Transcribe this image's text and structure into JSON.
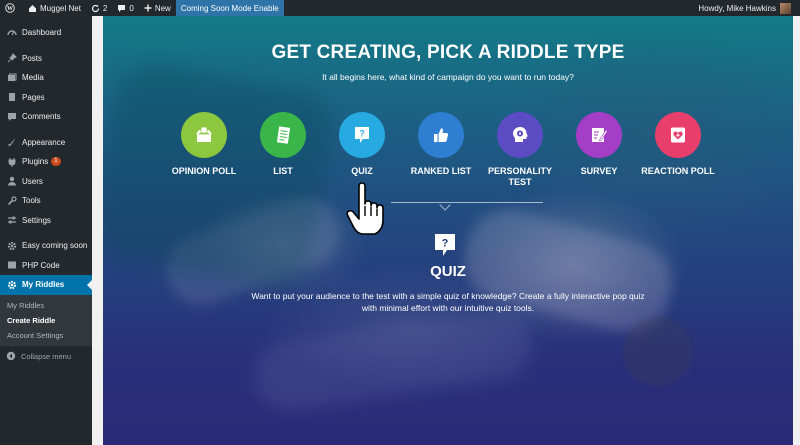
{
  "adminbar": {
    "site_name": "Muggel Net",
    "updates_count": "2",
    "comments_count": "0",
    "new_label": "New",
    "coming_soon_label": "Coming Soon Mode Enable",
    "howdy": "Howdy, Mike Hawkins"
  },
  "sidebar": {
    "dashboard": "Dashboard",
    "posts": "Posts",
    "media": "Media",
    "pages": "Pages",
    "comments": "Comments",
    "appearance": "Appearance",
    "plugins": "Plugins",
    "plugins_badge": "1",
    "users": "Users",
    "tools": "Tools",
    "settings": "Settings",
    "easy_coming_soon": "Easy coming soon",
    "php_code": "PHP Code",
    "my_riddles": "My Riddles",
    "sub_my_riddles": "My Riddles",
    "sub_create_riddle": "Create Riddle",
    "sub_account_settings": "Account Settings",
    "collapse": "Collapse menu"
  },
  "main": {
    "headline": "GET CREATING, PICK A RIDDLE TYPE",
    "subline": "It all begins here, what kind of campaign do you want to run today?",
    "types": [
      {
        "label": "OPINION POLL",
        "color": "#8dc63f",
        "icon": "ballot-box-icon"
      },
      {
        "label": "LIST",
        "color": "#39b54a",
        "icon": "list-icon"
      },
      {
        "label": "QUIZ",
        "color": "#27aae1",
        "icon": "question-icon"
      },
      {
        "label": "RANKED LIST",
        "color": "#2e7fd1",
        "icon": "thumbs-up-icon"
      },
      {
        "label": "PERSONALITY TEST",
        "color": "#5b4cc4",
        "icon": "head-brain-icon"
      },
      {
        "label": "SURVEY",
        "color": "#a43ec6",
        "icon": "survey-pencil-icon"
      },
      {
        "label": "REACTION POLL",
        "color": "#e83e6c",
        "icon": "heart-plus-icon"
      }
    ],
    "selected": {
      "title": "QUIZ",
      "description": "Want to put your audience to the test with a simple quiz of knowledge? Create a fully interactive pop quiz with minimal effort with our intuitive quiz tools."
    }
  }
}
